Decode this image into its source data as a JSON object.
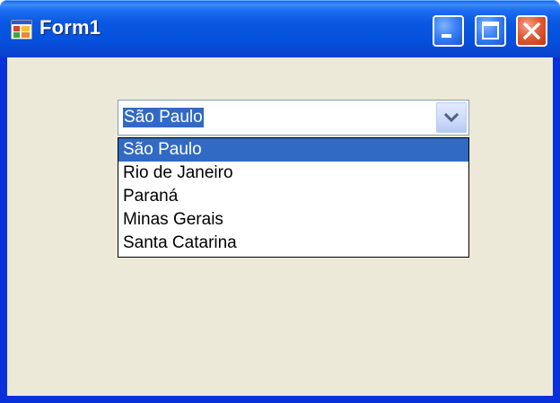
{
  "window": {
    "title": "Form1",
    "minimize_icon": "minimize-icon",
    "maximize_icon": "maximize-icon",
    "close_icon": "close-icon",
    "app_icon": "form-app-icon"
  },
  "combo": {
    "selected_value": "São Paulo",
    "arrow_icon": "chevron-down-icon",
    "expanded": true
  },
  "dropdown": {
    "items": [
      {
        "label": "São Paulo",
        "selected": true
      },
      {
        "label": "Rio de Janeiro",
        "selected": false
      },
      {
        "label": "Paraná",
        "selected": false
      },
      {
        "label": "Minas Gerais",
        "selected": false
      },
      {
        "label": "Santa Catarina",
        "selected": false
      }
    ]
  },
  "colors": {
    "titlebar": "#0a57e0",
    "client_background": "#ece9d8",
    "selection": "#316ac5",
    "close_button": "#e25d3a"
  }
}
